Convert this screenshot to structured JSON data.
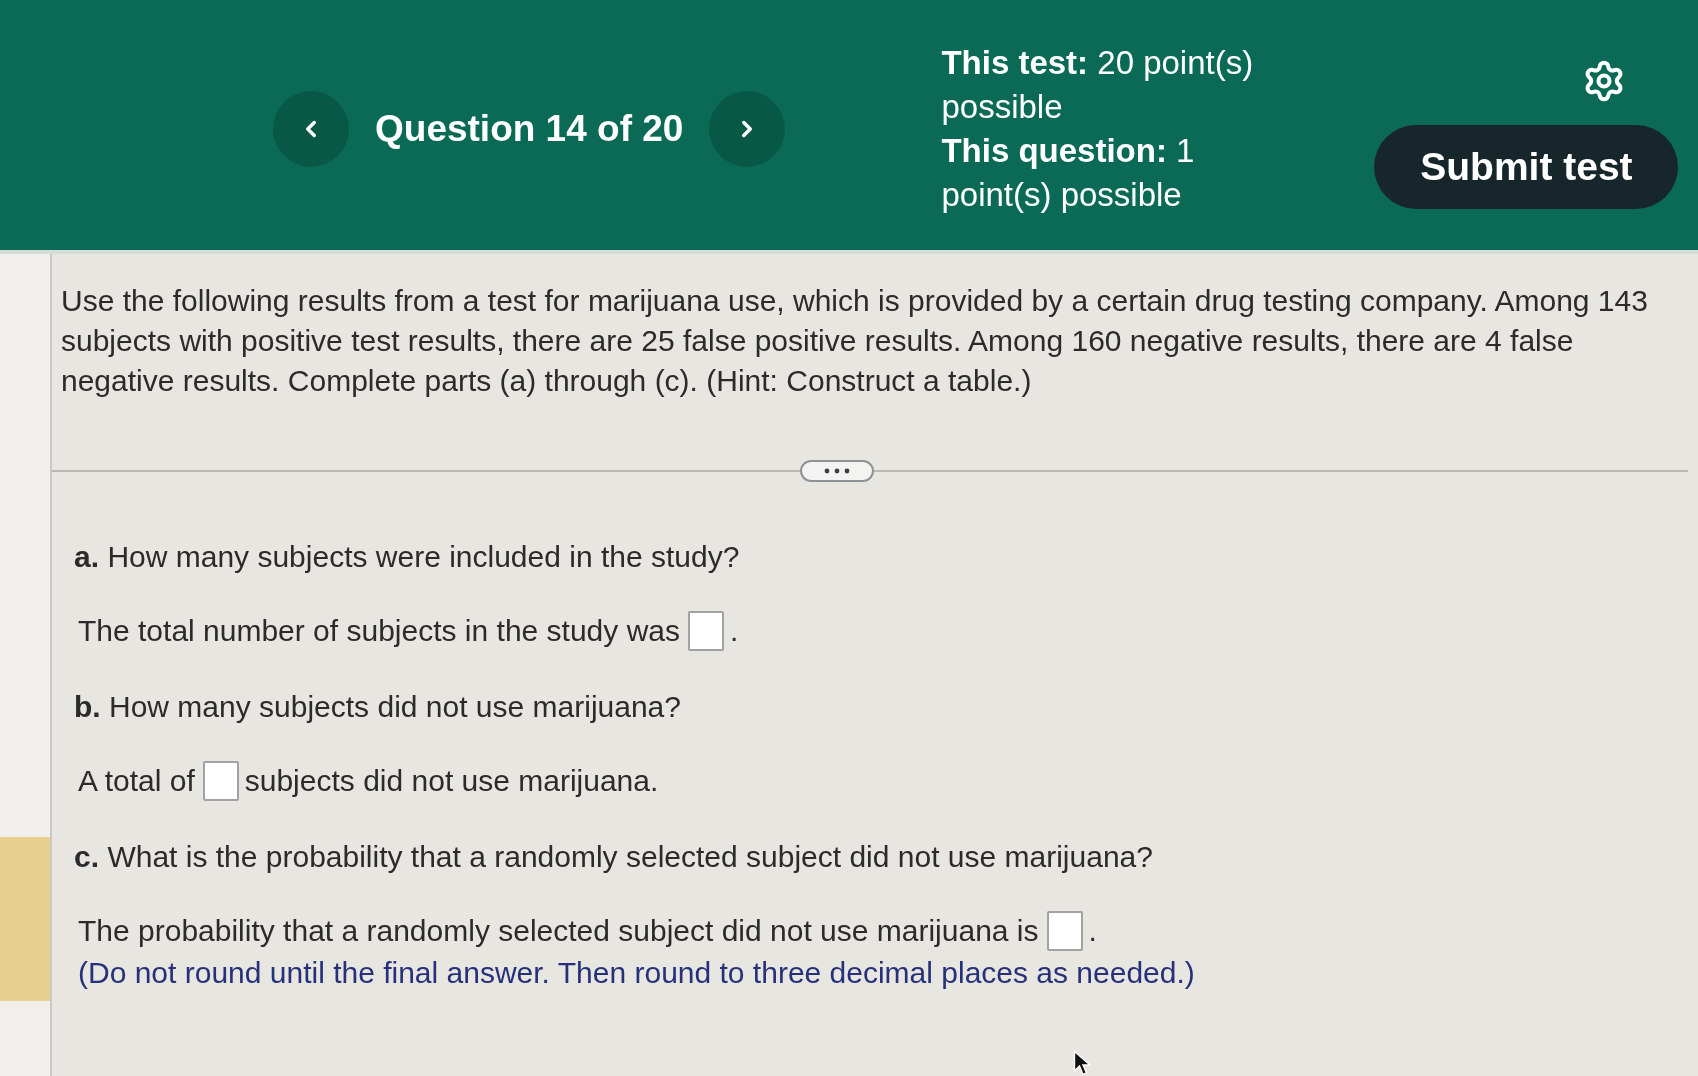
{
  "header": {
    "question_counter": "Question 14 of 20",
    "points": [
      {
        "label": "This test:",
        "value": "20 point(s) possible"
      },
      {
        "label": "This question:",
        "value": "1 point(s) possible"
      }
    ],
    "submit_button": "Submit test"
  },
  "question": {
    "text": "Use the following results from a test for marijuana use, which is provided by a certain drug testing company. Among 143 subjects with positive test results, there are 25 false positive results. Among 160 negative results, there are 4 false negative results. Complete parts (a) through (c). (Hint: Construct a table.)"
  },
  "parts": [
    {
      "letter": "a.",
      "prompt": "How many subjects were included in the study?",
      "answer": {
        "before": "The total number of subjects in the study was",
        "after": "."
      },
      "selected": false
    },
    {
      "letter": "b.",
      "prompt": "How many subjects did not use marijuana?",
      "answer": {
        "before": "A total of",
        "after": "subjects did not use marijuana."
      },
      "selected": false
    },
    {
      "letter": "c.",
      "prompt": "What is the probability that a randomly selected subject did not use marijuana?",
      "answer": {
        "before": "The probability that a randomly selected subject did not use marijuana is",
        "after": "."
      },
      "note": "(Do not round until the final answer. Then round to three decimal places as needed.)",
      "selected": true
    }
  ]
}
